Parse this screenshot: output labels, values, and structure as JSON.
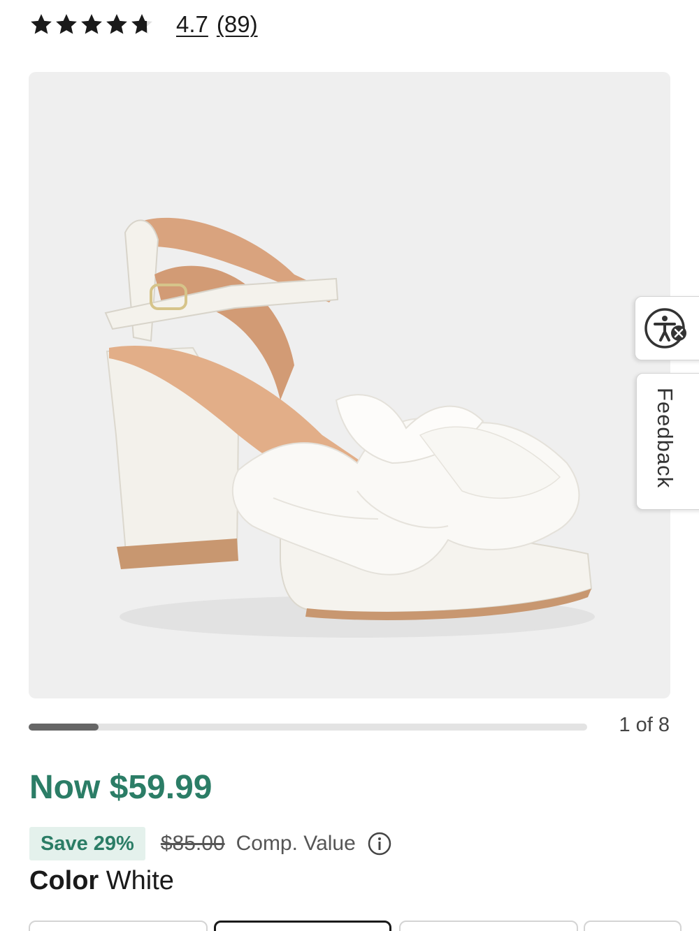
{
  "rating": {
    "value": "4.7",
    "count": "(89)",
    "stars": 4.7,
    "star_color": "#1a1a1a"
  },
  "gallery": {
    "image_icon": "white-platform-sandal-with-tulle-bow",
    "counter": "1 of 8",
    "progress": 0.125
  },
  "side_tabs": {
    "accessibility_icon": "accessibility-icon",
    "feedback_label": "Feedback"
  },
  "price": {
    "now": "Now $59.99",
    "save_badge": "Save 29%",
    "original": "$85.00",
    "comp_label": "Comp. Value",
    "accent": "#2b7d66"
  },
  "color": {
    "label": "Color",
    "value": "White"
  }
}
